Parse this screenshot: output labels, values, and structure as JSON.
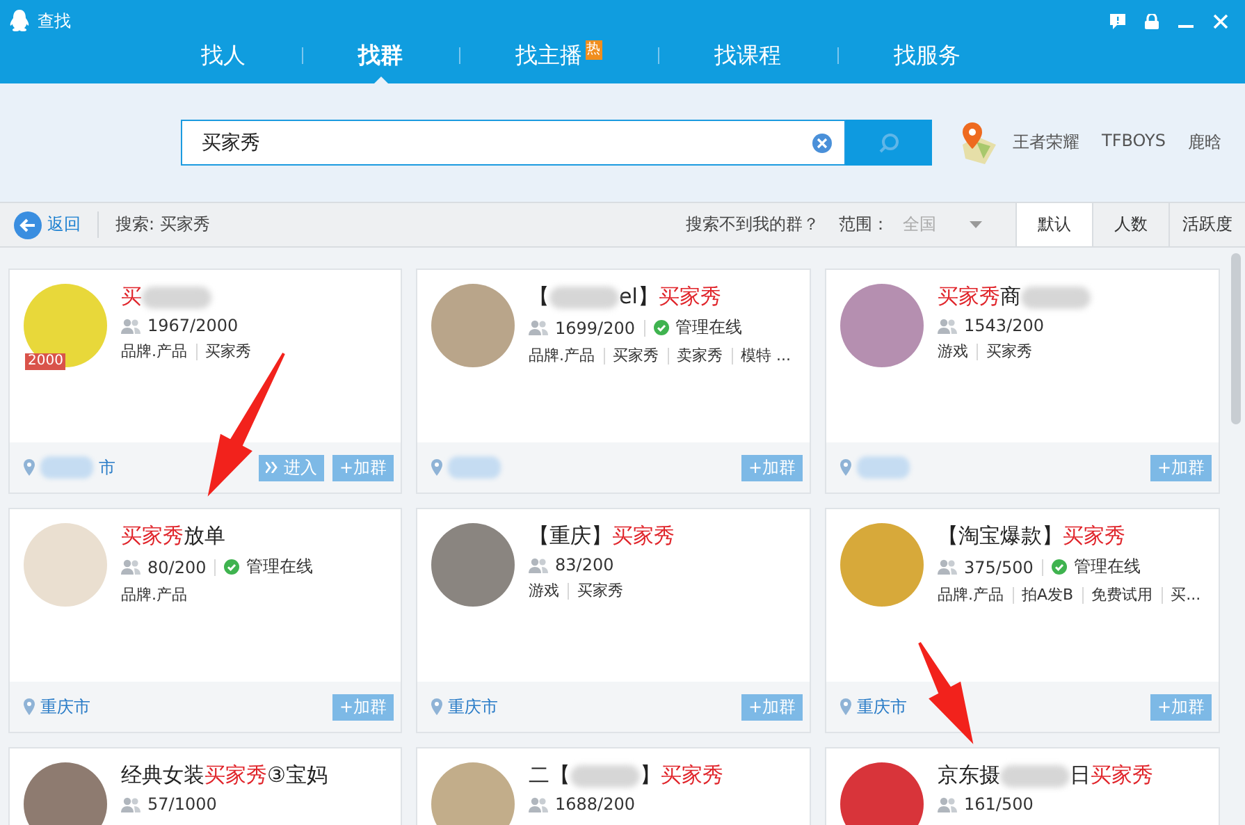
{
  "window": {
    "title": "查找"
  },
  "nav_tabs": [
    {
      "label": "找人",
      "selected": false
    },
    {
      "label": "找群",
      "selected": true
    },
    {
      "label": "找主播",
      "selected": false,
      "badge": "热"
    },
    {
      "label": "找课程",
      "selected": false
    },
    {
      "label": "找服务",
      "selected": false
    }
  ],
  "search": {
    "value": "买家秀"
  },
  "hot_words": [
    "王者荣耀",
    "TFBOYS",
    "鹿晗"
  ],
  "toolbar": {
    "back": "返回",
    "query": "搜索: 买家秀",
    "help_link": "搜索不到我的群？",
    "scope_label": "范围：",
    "scope": {
      "value": "全国",
      "disabled": true
    }
  },
  "sort_tabs": [
    {
      "label": "默认",
      "selected": true
    },
    {
      "label": "人数",
      "selected": false
    },
    {
      "label": "活跃度",
      "selected": false
    }
  ],
  "groups": [
    {
      "title": [
        {
          "kind": "text",
          "text": "买",
          "highlight": true
        },
        {
          "kind": "blur"
        }
      ],
      "badge": "2000",
      "members": "1967/2000",
      "tags": [
        "品牌.产品",
        "买家秀"
      ],
      "location": {
        "text": "市",
        "blurred": true
      },
      "buttons": [
        {
          "kind": "enter",
          "label": "进入"
        },
        {
          "kind": "join",
          "label": "+加群"
        }
      ]
    },
    {
      "title": [
        {
          "kind": "text",
          "text": "【",
          "highlight": false
        },
        {
          "kind": "blur"
        },
        {
          "kind": "text",
          "text": "el】",
          "highlight": false
        },
        {
          "kind": "text",
          "text": "买家秀",
          "highlight": true
        }
      ],
      "members": "1699/200",
      "admin_status": "管理在线",
      "tags": [
        "品牌.产品",
        "买家秀",
        "卖家秀",
        "模特 ..."
      ],
      "location": {
        "blurred": true
      },
      "buttons": [
        {
          "kind": "join",
          "label": "+加群"
        }
      ]
    },
    {
      "title": [
        {
          "kind": "text",
          "text": "买家秀",
          "highlight": true
        },
        {
          "kind": "text",
          "text": "商",
          "highlight": false
        },
        {
          "kind": "blur"
        }
      ],
      "members": "1543/200",
      "tags": [
        "游戏",
        "买家秀"
      ],
      "location": {
        "blurred": true
      },
      "buttons": [
        {
          "kind": "join",
          "label": "+加群"
        }
      ]
    },
    {
      "title": [
        {
          "kind": "text",
          "text": "买家秀",
          "highlight": true
        },
        {
          "kind": "text",
          "text": "放单",
          "highlight": false
        }
      ],
      "members": "80/200",
      "admin_status": "管理在线",
      "tags": [
        "品牌.产品"
      ],
      "location": {
        "text": "重庆市",
        "blurred": false
      },
      "buttons": [
        {
          "kind": "join",
          "label": "+加群"
        }
      ]
    },
    {
      "title": [
        {
          "kind": "text",
          "text": "【重庆】",
          "highlight": false
        },
        {
          "kind": "text",
          "text": "买家秀",
          "highlight": true
        }
      ],
      "members": "83/200",
      "tags": [
        "游戏",
        "买家秀"
      ],
      "location": {
        "text": "重庆市",
        "blurred": false
      },
      "buttons": [
        {
          "kind": "join",
          "label": "+加群"
        }
      ]
    },
    {
      "title": [
        {
          "kind": "text",
          "text": "【淘宝爆款】",
          "highlight": false
        },
        {
          "kind": "text",
          "text": "买家秀",
          "highlight": true
        }
      ],
      "members": "375/500",
      "admin_status": "管理在线",
      "tags": [
        "品牌.产品",
        "拍A发B",
        "免费试用",
        "买..."
      ],
      "location": {
        "text": "重庆市",
        "blurred": false
      },
      "buttons": [
        {
          "kind": "join",
          "label": "+加群"
        }
      ]
    },
    {
      "title": [
        {
          "kind": "text",
          "text": "经典女装",
          "highlight": false
        },
        {
          "kind": "text",
          "text": "买家秀",
          "highlight": true
        },
        {
          "kind": "text",
          "text": "③宝妈",
          "highlight": false
        }
      ],
      "members": "57/1000"
    },
    {
      "title": [
        {
          "kind": "text",
          "text": "二【",
          "highlight": false
        },
        {
          "kind": "blur"
        },
        {
          "kind": "text",
          "text": "】",
          "highlight": false
        },
        {
          "kind": "text",
          "text": "买家秀",
          "highlight": true
        }
      ],
      "members": "1688/200"
    },
    {
      "title": [
        {
          "kind": "text",
          "text": "京东摄",
          "highlight": false
        },
        {
          "kind": "blur"
        },
        {
          "kind": "text",
          "text": "日",
          "highlight": false
        },
        {
          "kind": "text",
          "text": "买家秀",
          "highlight": true
        }
      ],
      "members": "161/500"
    }
  ],
  "annotation_arrows": [
    {
      "kind": "arrow"
    },
    {
      "kind": "arrow"
    }
  ]
}
